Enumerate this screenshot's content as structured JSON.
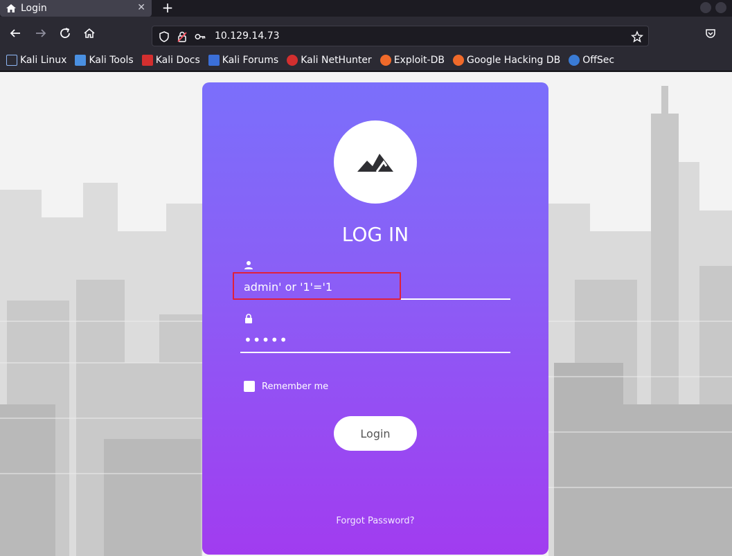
{
  "browser": {
    "tab": {
      "title": "Login",
      "close_glyph": "✕",
      "icon": "home-icon"
    },
    "new_tab_glyph": "+",
    "url": "10.129.14.73",
    "bookmarks": [
      {
        "label": "Kali Linux",
        "color": "#8fb7f5"
      },
      {
        "label": "Kali Tools",
        "color": "#4a90e2"
      },
      {
        "label": "Kali Docs",
        "color": "#d32f2f"
      },
      {
        "label": "Kali Forums",
        "color": "#3b6fd8"
      },
      {
        "label": "Kali NetHunter",
        "color": "#d32f2f"
      },
      {
        "label": "Exploit-DB",
        "color": "#f06a2a"
      },
      {
        "label": "Google Hacking DB",
        "color": "#f06a2a"
      },
      {
        "label": "OffSec",
        "color": "#3a7bd5"
      }
    ]
  },
  "login": {
    "title": "LOG IN",
    "username_value": "admin' or '1'='1",
    "password_value": "•••••",
    "remember_label": "Remember me",
    "login_button": "Login",
    "forgot_link": "Forgot Password?"
  },
  "colors": {
    "card_top": "#7b6ffb",
    "card_bottom": "#a13cf0",
    "highlight": "#e0203a"
  }
}
